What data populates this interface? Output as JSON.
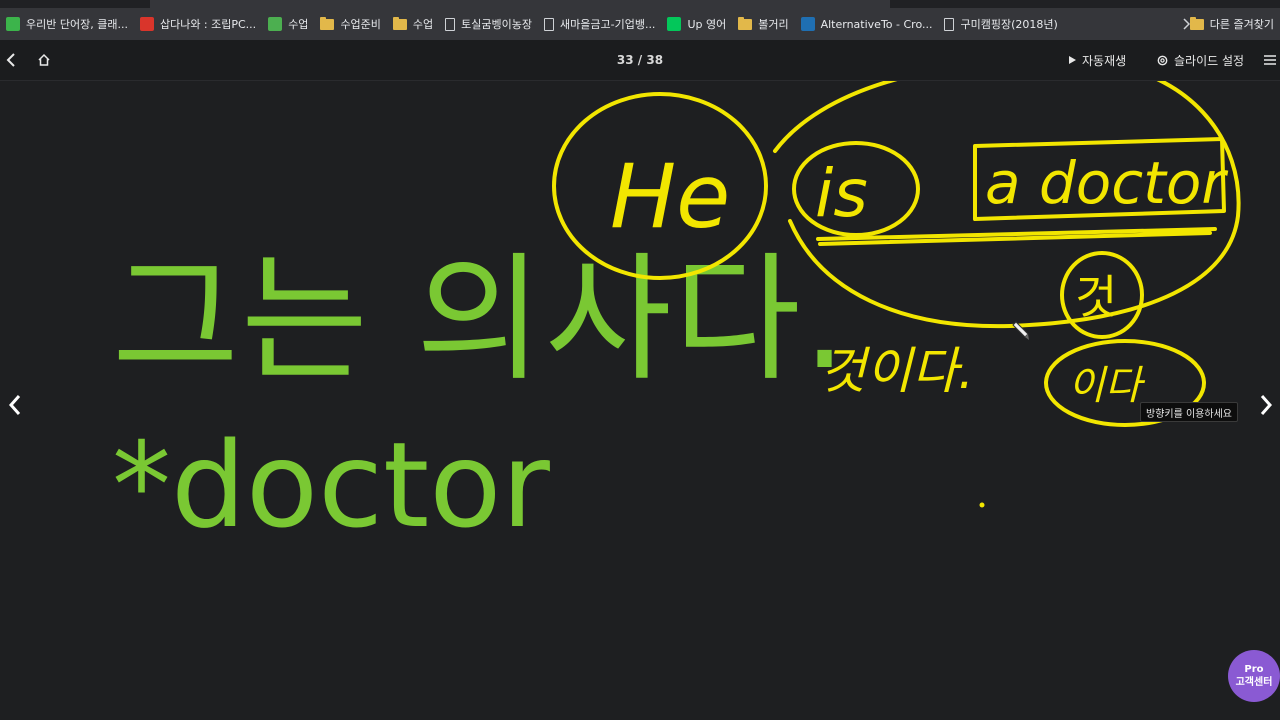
{
  "bookmarks": [
    {
      "label": "우리반 단어장, 클래...",
      "icon": "classcard-icon",
      "color": "#3cb44b"
    },
    {
      "label": "삽다나와 : 조립PC...",
      "icon": "danawa-icon",
      "color": "#d9352b"
    },
    {
      "label": "수업",
      "icon": "image-icon",
      "color": "#4caf50"
    },
    {
      "label": "수업준비",
      "icon": "folder-icon"
    },
    {
      "label": "수업",
      "icon": "folder-icon"
    },
    {
      "label": "토실굼벵이농장",
      "icon": "page-icon"
    },
    {
      "label": "새마을금고-기업뱅...",
      "icon": "page-icon"
    },
    {
      "label": "Up 영어",
      "icon": "naver-icon",
      "color": "#03c75a"
    },
    {
      "label": "볼거리",
      "icon": "folder-icon"
    },
    {
      "label": "AlternativeTo - Cro...",
      "icon": "alternativeto-icon",
      "color": "#1f6fb2"
    },
    {
      "label": "구미캠핑장(2018년)",
      "icon": "page-icon"
    }
  ],
  "bookmarks_other": "다른 즐겨찾기",
  "toolbar": {
    "page_indicator": "33 / 38",
    "autoplay_label": "자동재생",
    "settings_label": "슬라이드 설정"
  },
  "slide": {
    "line1": "그는 의사다.",
    "line2": "*doctor"
  },
  "annotations": {
    "he": "He",
    "is": "is",
    "a_doctor": "a doctor",
    "note1": "것",
    "note2": "것이다.",
    "note3": "이다"
  },
  "tooltip": "방향키를 이용하세요",
  "support": {
    "badge": "Pro",
    "label": "고객센터"
  },
  "colors": {
    "slide_text": "#7ac833",
    "ink": "#f2e600",
    "support": "#8a5ad3",
    "background": "#1e1f21"
  }
}
